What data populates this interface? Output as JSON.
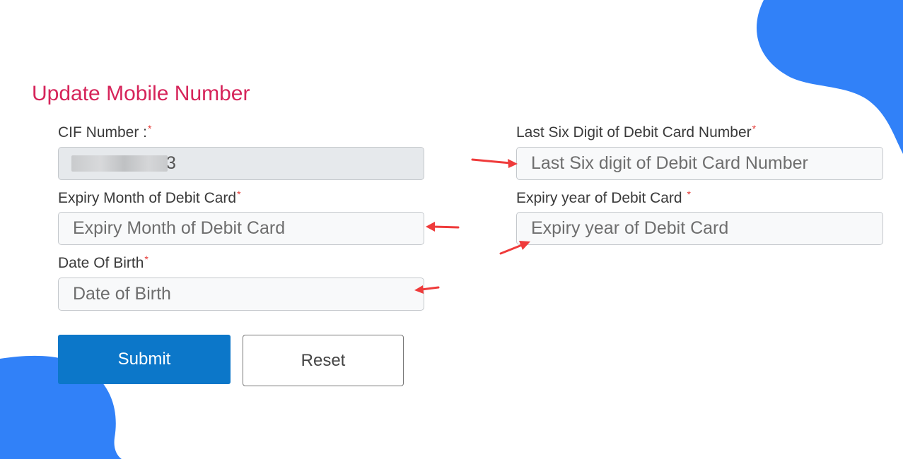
{
  "form": {
    "title": "Update Mobile Number",
    "required_mark": "*",
    "cif": {
      "label": "CIF Number :",
      "value": "3"
    },
    "debit_last_six": {
      "label": "Last Six Digit of Debit Card Number",
      "placeholder": "Last Six digit of Debit Card Number"
    },
    "expiry_month": {
      "label": "Expiry Month of Debit Card",
      "placeholder": "Expiry Month of Debit Card"
    },
    "expiry_year": {
      "label": "Expiry year of Debit Card ",
      "placeholder": "Expiry year of Debit Card"
    },
    "dob": {
      "label": "Date Of Birth",
      "placeholder": "Date of Birth"
    },
    "buttons": {
      "submit": "Submit",
      "reset": "Reset"
    }
  },
  "colors": {
    "title": "#d6245a",
    "required": "#e53935",
    "submit_bg": "#0c77c9",
    "decor_blob": "#3181f8",
    "annotation_arrow": "#ef3b3b"
  }
}
